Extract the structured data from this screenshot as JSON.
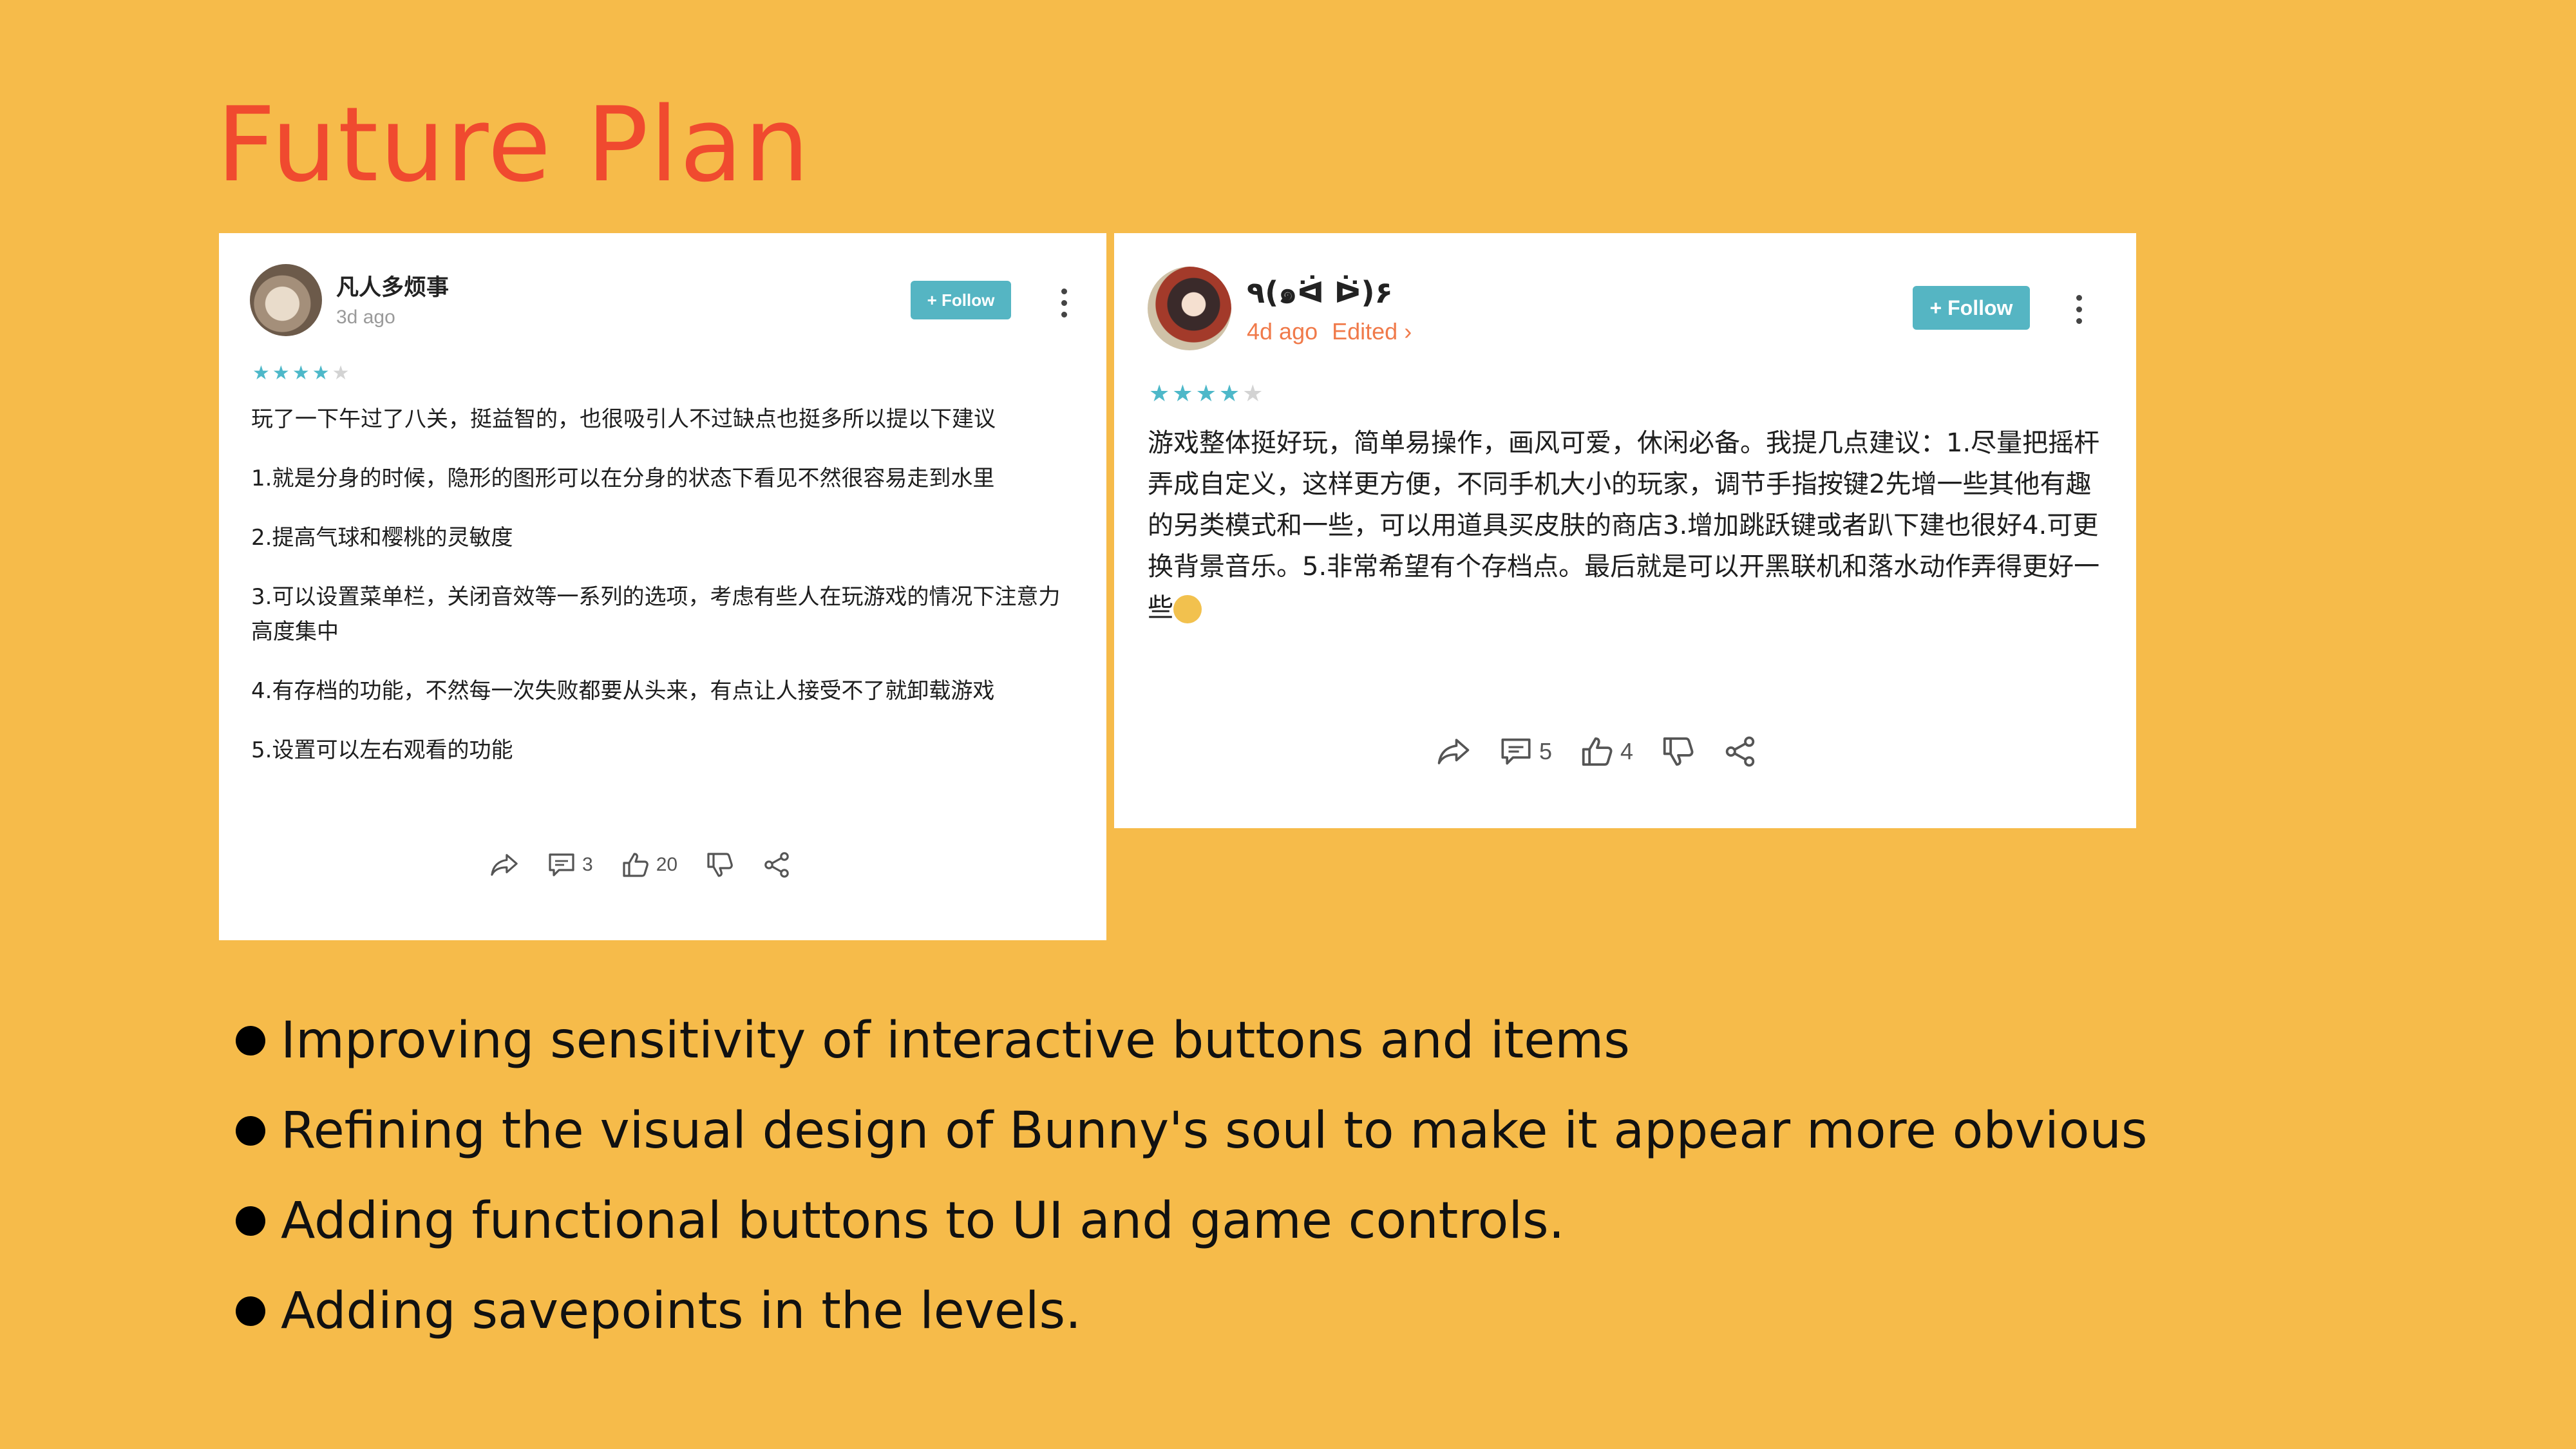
{
  "slide": {
    "title": "Future Plan"
  },
  "reviews": [
    {
      "username": "凡人多烦事",
      "time": "3d ago",
      "edited": "",
      "follow_label": "+ Follow",
      "rating": 4,
      "rating_max": 5,
      "paragraphs": [
        "玩了一下午过了八关，挺益智的，也很吸引人不过缺点也挺多所以提以下建议",
        "1.就是分身的时候，隐形的图形可以在分身的状态下看见不然很容易走到水里",
        "2.提高气球和樱桃的灵敏度",
        "3.可以设置菜单栏，关闭音效等一系列的选项，考虑有些人在玩游戏的情况下注意力高度集中",
        "4.有存档的功能，不然每一次失败都要从头来，有点让人接受不了就卸载游戏",
        "5.设置可以左右观看的功能"
      ],
      "comments": "3",
      "likes": "20",
      "icons": [
        "avatar",
        "more-vertical-icon",
        "star-icon",
        "share-arrow-icon",
        "comment-icon",
        "thumbs-up-icon",
        "thumbs-down-icon",
        "share-nodes-icon"
      ]
    },
    {
      "username": "٩(๑ᐛ ᐖ)۶",
      "time": "4d ago",
      "edited": "Edited ›",
      "follow_label": "+ Follow",
      "rating": 4,
      "rating_max": 5,
      "paragraphs": [
        "游戏整体挺好玩，简单易操作，画风可爱，休闲必备。我提几点建议：1.尽量把摇杆弄成自定义，这样更方便，不同手机大小的玩家，调节手指按键2先增一些其他有趣的另类模式和一些，可以用道具买皮肤的商店3.增加跳跃键或者趴下建也很好4.可更换背景音乐。5.非常希望有个存档点。最后就是可以开黑联机和落水动作弄得更好一些"
      ],
      "comments": "5",
      "likes": "4",
      "icons": [
        "avatar",
        "more-vertical-icon",
        "star-icon",
        "share-arrow-icon",
        "comment-icon",
        "thumbs-up-icon",
        "thumbs-down-icon",
        "share-nodes-icon",
        "cat-emoji-icon"
      ]
    }
  ],
  "bullets": [
    "Improving sensitivity of interactive buttons and items",
    "Refining the visual design of Bunny's soul to make it appear more obvious",
    "Adding functional buttons to UI and game controls.",
    "Adding savepoints in the levels."
  ],
  "colors": {
    "background": "#F6BB4A",
    "title": "#F04A2F",
    "follow": "#55B5C3",
    "star": "#4DB8C9",
    "edited": "#F07A4A"
  }
}
